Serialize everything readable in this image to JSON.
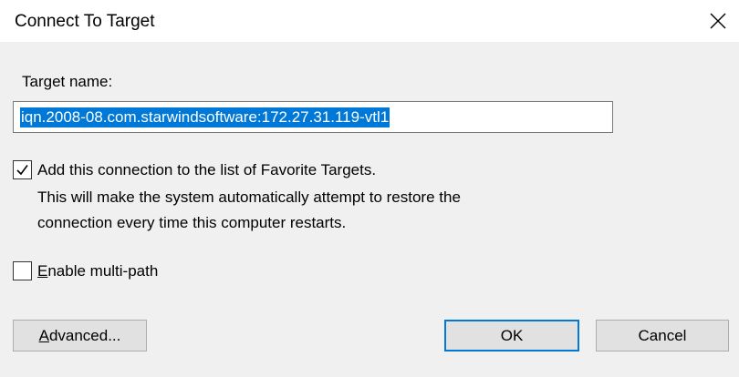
{
  "dialog": {
    "title": "Connect To Target",
    "close_glyph": "✕"
  },
  "target": {
    "label": "Target name:",
    "value": "iqn.2008-08.com.starwindsoftware:172.27.31.119-vtl1",
    "selected": true
  },
  "favorite": {
    "checked": true,
    "label": "Add this connection to the list of Favorite Targets.",
    "description_line1": "This will make the system automatically attempt to restore the",
    "description_line2": "connection every time this computer restarts."
  },
  "multipath": {
    "checked": false,
    "label_accel": "E",
    "label_rest": "nable multi-path"
  },
  "buttons": {
    "advanced_accel": "A",
    "advanced_rest": "dvanced...",
    "ok": "OK",
    "cancel": "Cancel"
  },
  "icons": {
    "close": "close-icon",
    "check": "checkmark-icon"
  },
  "colors": {
    "accent": "#0078d7",
    "dialog_bg": "#f0f0f0",
    "titlebar_bg": "#ffffff",
    "button_bg": "#e1e1e1"
  }
}
